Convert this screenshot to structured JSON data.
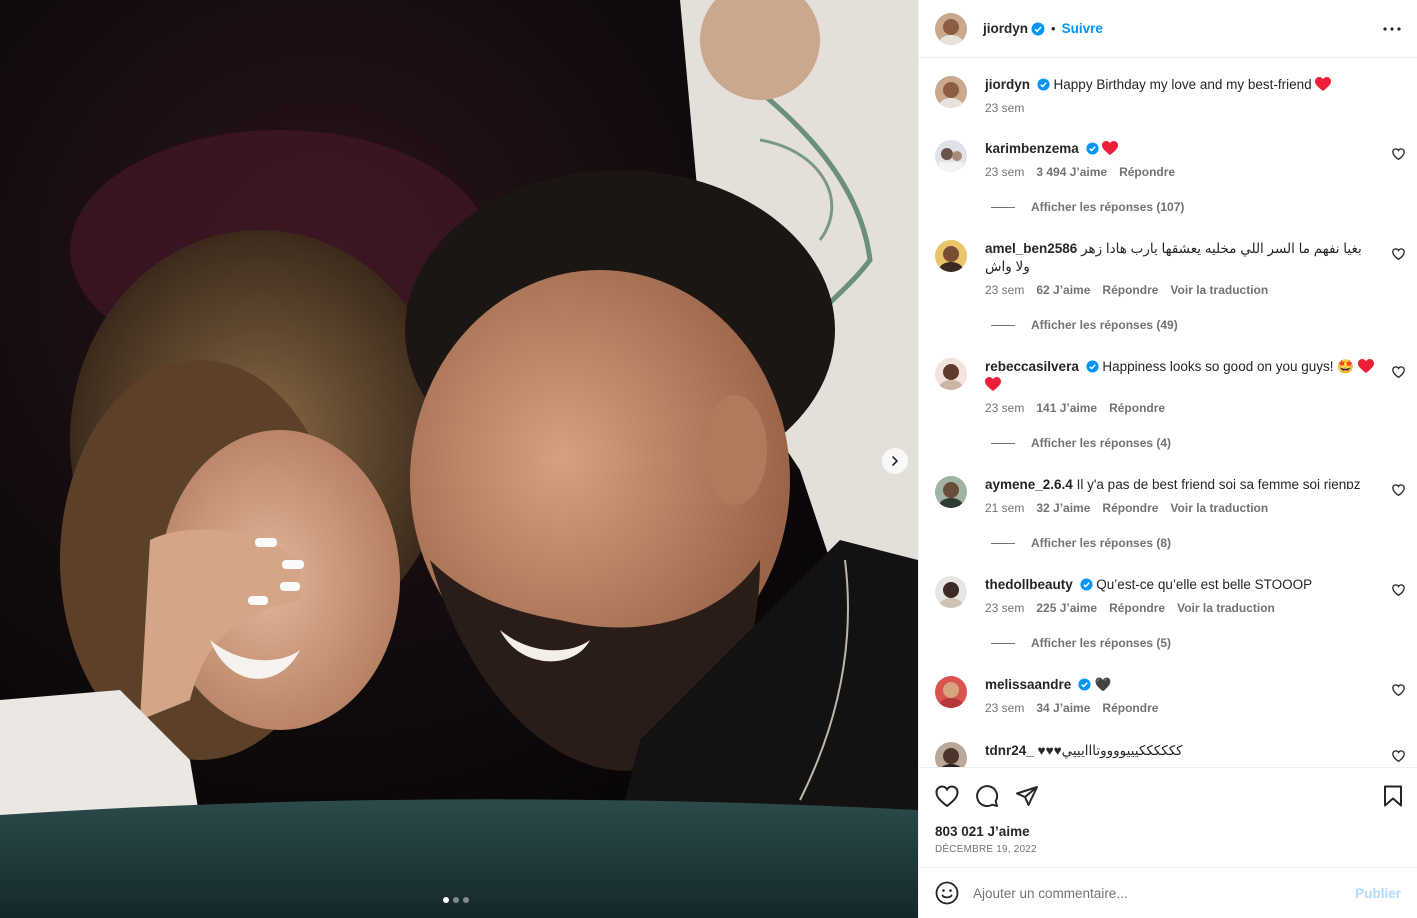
{
  "header": {
    "username": "jiordyn",
    "bullet": "•",
    "follow_label": "Suivre"
  },
  "caption": {
    "username": "jiordyn",
    "text": "Happy Birthday my love and my best-friend",
    "time": "23 sem"
  },
  "comments": [
    {
      "username": "karimbenzema",
      "verified": true,
      "text": "",
      "time": "23 sem",
      "likes": "3 494 J’aime",
      "reply": "Répondre",
      "translate": "",
      "replies": "Afficher les réponses (107)"
    },
    {
      "username": "amel_ben2586",
      "verified": false,
      "text": "بغيا نفهم ما السر اللي مخليه يعشقها يارب هادا زهر ولا واش",
      "time": "23 sem",
      "likes": "62 J’aime",
      "reply": "Répondre",
      "translate": "Voir la traduction",
      "replies": "Afficher les réponses (49)"
    },
    {
      "username": "rebeccasilvera",
      "verified": true,
      "text": "Happiness looks so good on you guys! 🤩",
      "time": "23 sem",
      "likes": "141 J’aime",
      "reply": "Répondre",
      "translate": "",
      "replies": "Afficher les réponses (4)"
    },
    {
      "username": "aymene_2.6.4",
      "verified": false,
      "text": "Il y'a pas de best friend soi sa femme soi rienɒz",
      "time": "21 sem",
      "likes": "32 J’aime",
      "reply": "Répondre",
      "translate": "Voir la traduction",
      "replies": "Afficher les réponses (8)"
    },
    {
      "username": "thedollbeauty",
      "verified": true,
      "text": "Qu’est-ce qu’elle est belle STOOOP",
      "time": "23 sem",
      "likes": "225 J’aime",
      "reply": "Répondre",
      "translate": "Voir la traduction",
      "replies": "Afficher les réponses (5)"
    },
    {
      "username": "melissaandre",
      "verified": true,
      "text": "🖤",
      "time": "23 sem",
      "likes": "34 J’aime",
      "reply": "Répondre",
      "translate": "",
      "replies": ""
    },
    {
      "username": "tdnr24_",
      "verified": false,
      "text": "♥♥♥ككككككيييووووتااايييي",
      "time": "",
      "likes": "",
      "reply": "",
      "translate": "",
      "replies": ""
    }
  ],
  "footer": {
    "likes": "803 021 J’aime",
    "date": "DÉCEMBRE 19, 2022",
    "comment_placeholder": "Ajouter un commentaire...",
    "publish_label": "Publier"
  },
  "carousel": {
    "slides": 3,
    "active": 0
  },
  "colors": {
    "link": "#0095f6",
    "verified": "#0095f6",
    "heart": "#ed1e37",
    "muted": "#737373"
  },
  "icons": [
    "verified-badge-icon",
    "more-options-icon",
    "heart-icon",
    "comment-icon",
    "share-icon",
    "bookmark-icon",
    "emoji-icon",
    "chevron-right-icon"
  ]
}
